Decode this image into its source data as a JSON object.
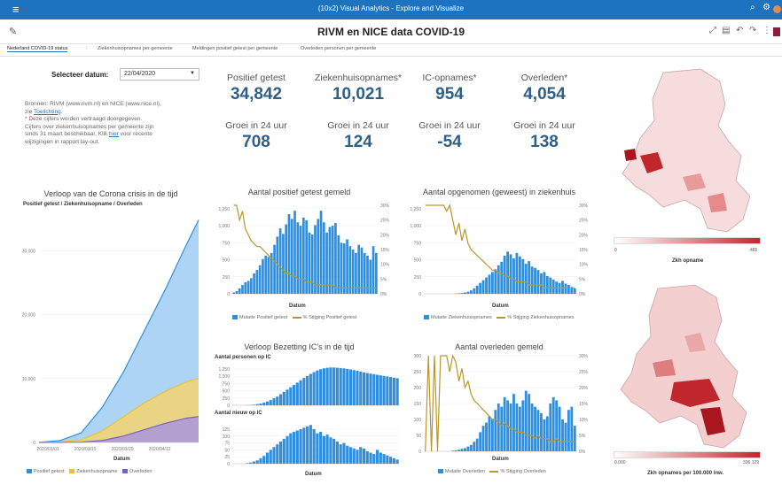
{
  "app": {
    "title": "(10x2) Visual Analytics - Explore and Visualize"
  },
  "report": {
    "title": "RIVM en NICE data COVID-19"
  },
  "tabs": [
    {
      "label": "Nederland COVID-19 status"
    },
    {
      "label": "Ziekenhuisopnames per gemeente"
    },
    {
      "label": "Meldingen positief getest per gemeente"
    },
    {
      "label": "Overleden personen per gemeente"
    }
  ],
  "date": {
    "label": "Selecteer datum:",
    "value": "22/04/2020"
  },
  "note": {
    "l1": "Bronnen: RIVM (www.rivm.nl) en NICE (www.nice.nl),",
    "l2a": "zie ",
    "l2b": "Toelichting",
    "l2c": ".",
    "l3": "* Deze cijfers worden vertraagd doorgegeven.",
    "l4": "Cijfers over ziekenhuisopnames per gemeente zijn",
    "l5a": "sinds 31 maart beschikbaar. Klik ",
    "l5b": "hier",
    "l5c": " voor recente",
    "l6": "wijzigingen in rapport lay-out."
  },
  "kpis": [
    {
      "label": "Positief getest",
      "value": "34,842",
      "growth_label": "Groei in 24 uur",
      "growth": "708"
    },
    {
      "label": "Ziekenhuisopnames*",
      "value": "10,021",
      "growth_label": "Groei in 24 uur",
      "growth": "124"
    },
    {
      "label": "IC-opnames*",
      "value": "954",
      "growth_label": "Groei in 24 uur",
      "growth": "-54"
    },
    {
      "label": "Overleden*",
      "value": "4,054",
      "growth_label": "Groei in 24 uur",
      "growth": "138"
    }
  ],
  "colors": {
    "blue": "#2f8fde",
    "gold": "#b8962a",
    "purple": "#7b5cc4",
    "header": "#1e73be",
    "map_dark": "#c0272d"
  },
  "icons": [
    "hamburger-icon",
    "search-icon",
    "settings-icon",
    "user-avatar-icon",
    "edit-icon",
    "expand-icon",
    "export-icon",
    "undo-icon",
    "redo-icon",
    "more-icon"
  ],
  "map1": {
    "scale_min": "0",
    "scale_max": "485",
    "caption": "Zkh opname"
  },
  "map2": {
    "scale_min": "0.000",
    "scale_max": "336.129",
    "caption": "Zkh opnames per 100.000 inw."
  },
  "chart_data": [
    {
      "id": "cumulative",
      "type": "area",
      "title": "Verloop van de Corona crisis in de tijd",
      "subtitle": "Positief getest / Ziekenhuisopname / Overleden",
      "xlabel": "Datum",
      "ylim": [
        0,
        36000
      ],
      "yticks": [
        "0",
        "10,000",
        "20,000",
        "30,000"
      ],
      "xticks": [
        "2020/03/01",
        "2020/03/15",
        "2020/03/29",
        "2020/04/12"
      ],
      "x": [
        0,
        7,
        14,
        21,
        28,
        35,
        42,
        49,
        53
      ],
      "series": [
        {
          "name": "Positief getest",
          "color": "#2f8fde",
          "values": [
            10,
            300,
            1500,
            5500,
            11000,
            17500,
            24000,
            31000,
            34842
          ]
        },
        {
          "name": "Ziekenhuisopname",
          "color": "#e9c23a",
          "values": [
            0,
            50,
            400,
            1800,
            4000,
            6200,
            8000,
            9500,
            10021
          ]
        },
        {
          "name": "Overleden",
          "color": "#7b5cc4",
          "values": [
            0,
            5,
            50,
            300,
            1000,
            2000,
            3000,
            3800,
            4054
          ]
        }
      ]
    },
    {
      "id": "positief",
      "type": "bar",
      "title": "Aantal positief getest gemeld",
      "xlabel": "Datum",
      "ylim": [
        0,
        1300
      ],
      "yticks": [
        "0",
        "250",
        "500",
        "750",
        "1,000",
        "1,250"
      ],
      "y2ticks": [
        "0%",
        "5%",
        "10%",
        "15%",
        "20%",
        "25%",
        "30%"
      ],
      "series": [
        {
          "name": "Mutatie Positief getest",
          "color": "#2f8fde",
          "values": [
            20,
            40,
            80,
            130,
            170,
            190,
            230,
            300,
            350,
            420,
            510,
            560,
            540,
            600,
            720,
            840,
            960,
            880,
            1020,
            1170,
            1100,
            1220,
            1050,
            1000,
            1120,
            1080,
            900,
            870,
            1010,
            1100,
            1220,
            1050,
            900,
            980,
            1000,
            1040,
            860,
            750,
            740,
            800,
            700,
            650,
            600,
            720,
            680,
            600,
            560,
            500,
            700,
            600
          ]
        },
        {
          "name": "% Stijging Positief getest",
          "color": "#b8962a",
          "values": [
            30,
            30,
            25,
            28,
            22,
            20,
            18,
            17,
            16,
            16,
            15,
            14,
            13,
            12,
            11,
            10,
            9,
            8,
            7,
            7,
            6,
            6,
            5,
            5,
            5,
            4,
            4,
            4,
            3,
            3,
            3,
            3,
            3,
            3,
            3,
            2,
            2,
            2,
            2,
            2,
            2,
            2,
            2,
            2,
            2,
            2,
            2,
            2,
            2,
            2
          ]
        }
      ]
    },
    {
      "id": "opgenomen",
      "type": "bar",
      "title": "Aantal opgenomen (geweest) in ziekenhuis",
      "xlabel": "Datum",
      "ylim": [
        0,
        1300
      ],
      "yticks": [
        "0",
        "250",
        "500",
        "750",
        "1,000",
        "1,250"
      ],
      "y2ticks": [
        "0%",
        "5%",
        "10%",
        "15%",
        "20%",
        "25%",
        "30%"
      ],
      "series": [
        {
          "name": "Mutatie Ziekenhuisopnames",
          "color": "#2f8fde",
          "values": [
            0,
            0,
            0,
            0,
            0,
            0,
            0,
            0,
            0,
            0,
            5,
            8,
            12,
            20,
            30,
            50,
            80,
            120,
            160,
            200,
            240,
            280,
            320,
            360,
            420,
            470,
            560,
            620,
            580,
            520,
            600,
            550,
            510,
            440,
            480,
            400,
            380,
            350,
            300,
            320,
            260,
            240,
            210,
            180,
            160,
            190,
            150,
            130,
            100,
            80
          ]
        },
        {
          "name": "% Stijging Ziekenhuisopnames",
          "color": "#b8962a",
          "values": [
            30,
            30,
            30,
            30,
            30,
            30,
            30,
            28,
            30,
            25,
            20,
            24,
            18,
            22,
            17,
            15,
            14,
            13,
            12,
            11,
            10,
            9,
            8,
            8,
            7,
            7,
            6,
            6,
            5,
            5,
            4,
            4,
            4,
            4,
            3,
            3,
            3,
            3,
            3,
            2,
            2,
            2,
            2,
            2,
            2,
            2,
            2,
            2,
            2,
            2
          ]
        }
      ]
    },
    {
      "id": "icbezetting",
      "type": "bar",
      "title": "Verloop Bezetting IC's in de tijd",
      "subtitle": "Aantal personen op IC",
      "ylim": [
        0,
        1400
      ],
      "yticks": [
        "0",
        "250",
        "500",
        "750",
        "1,000",
        "1,250"
      ],
      "series": [
        {
          "name": "Aantal personen op IC",
          "color": "#2f8fde",
          "values": [
            0,
            0,
            0,
            0,
            5,
            10,
            20,
            40,
            60,
            90,
            130,
            180,
            240,
            300,
            380,
            460,
            540,
            620,
            700,
            780,
            860,
            940,
            1010,
            1080,
            1140,
            1200,
            1240,
            1270,
            1290,
            1300,
            1300,
            1290,
            1280,
            1270,
            1250,
            1230,
            1210,
            1190,
            1160,
            1130,
            1110,
            1090,
            1070,
            1050,
            1030,
            1010,
            990,
            970,
            950,
            930
          ]
        }
      ]
    },
    {
      "id": "icnieuw",
      "type": "bar",
      "subtitle": "Aantal nieuw op IC",
      "xlabel": "Datum",
      "ylim": [
        0,
        160
      ],
      "yticks": [
        "0",
        "25",
        "50",
        "75",
        "100",
        "125"
      ],
      "series": [
        {
          "name": "Aantal nieuw op IC",
          "color": "#2f8fde",
          "values": [
            0,
            0,
            0,
            0,
            2,
            4,
            8,
            12,
            20,
            28,
            40,
            50,
            60,
            70,
            80,
            90,
            100,
            110,
            115,
            120,
            125,
            130,
            135,
            140,
            125,
            110,
            115,
            100,
            105,
            95,
            90,
            80,
            70,
            75,
            65,
            60,
            55,
            50,
            60,
            55,
            45,
            40,
            35,
            50,
            40,
            35,
            30,
            25,
            20,
            15
          ]
        }
      ]
    },
    {
      "id": "overleden",
      "type": "bar",
      "title": "Aantal overleden gemeld",
      "xlabel": "Datum",
      "ylim": [
        0,
        300
      ],
      "yticks": [
        "0",
        "50",
        "100",
        "150",
        "200",
        "250",
        "300"
      ],
      "y2ticks": [
        "0%",
        "5%",
        "10%",
        "15%",
        "20%",
        "25%",
        "30%"
      ],
      "series": [
        {
          "name": "Mutatie Overleden",
          "color": "#2f8fde",
          "values": [
            0,
            0,
            0,
            0,
            0,
            0,
            0,
            0,
            0,
            2,
            3,
            5,
            8,
            10,
            15,
            20,
            30,
            40,
            60,
            80,
            90,
            110,
            100,
            130,
            150,
            140,
            170,
            160,
            150,
            180,
            150,
            140,
            160,
            190,
            180,
            150,
            140,
            130,
            120,
            100,
            110,
            150,
            170,
            160,
            140,
            100,
            90,
            130,
            140,
            80
          ]
        },
        {
          "name": "% Stijging Overleden",
          "color": "#b8962a",
          "values": [
            0,
            30,
            0,
            30,
            0,
            30,
            30,
            30,
            25,
            30,
            28,
            22,
            26,
            20,
            22,
            18,
            16,
            15,
            14,
            13,
            12,
            11,
            10,
            10,
            9,
            8,
            9,
            8,
            7,
            7,
            6,
            6,
            6,
            5,
            5,
            5,
            4,
            5,
            4,
            4,
            4,
            3,
            3,
            4,
            3,
            3,
            3,
            3,
            3,
            3
          ]
        }
      ]
    }
  ]
}
